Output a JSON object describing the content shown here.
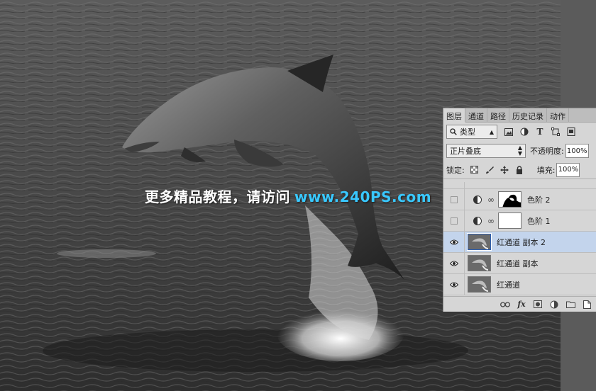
{
  "watermark": {
    "text_cn": "更多精品教程，请访问",
    "text_url": "www.240PS.com"
  },
  "layers_panel": {
    "tabs": [
      {
        "label": "图层",
        "active": true
      },
      {
        "label": "通道",
        "active": false
      },
      {
        "label": "路径",
        "active": false
      },
      {
        "label": "历史记录",
        "active": false
      },
      {
        "label": "动作",
        "active": false
      }
    ],
    "filter": {
      "icon": "search-icon",
      "label": "类型"
    },
    "filter_icons": [
      "image-filter-icon",
      "adjustment-filter-icon",
      "type-filter-icon",
      "shape-filter-icon",
      "smart-object-filter-icon"
    ],
    "blend_mode": "正片叠底",
    "opacity_label": "不透明度:",
    "opacity_value": "100%",
    "lock_label": "锁定:",
    "fill_label": "填充:",
    "fill_value": "100%",
    "layers": [
      {
        "name": "色阶 2",
        "type": "adjustment",
        "visible": false,
        "selected": false
      },
      {
        "name": "色阶 1",
        "type": "adjustment",
        "visible": false,
        "selected": false
      },
      {
        "name": "红通道 副本 2",
        "type": "pixel",
        "visible": true,
        "selected": true
      },
      {
        "name": "红通道 副本",
        "type": "pixel",
        "visible": true,
        "selected": false
      },
      {
        "name": "红通道",
        "type": "pixel",
        "visible": true,
        "selected": false
      }
    ],
    "bottom_icons": [
      "link-icon",
      "fx-icon",
      "mask-icon",
      "adjustment-layer-icon",
      "group-folder-icon",
      "new-layer-icon"
    ],
    "fx_label": "fx"
  },
  "colors": {
    "selected_layer": "#c3d4ec",
    "watermark_url": "#39c8ff",
    "panel_bg": "#d6d6d6"
  }
}
